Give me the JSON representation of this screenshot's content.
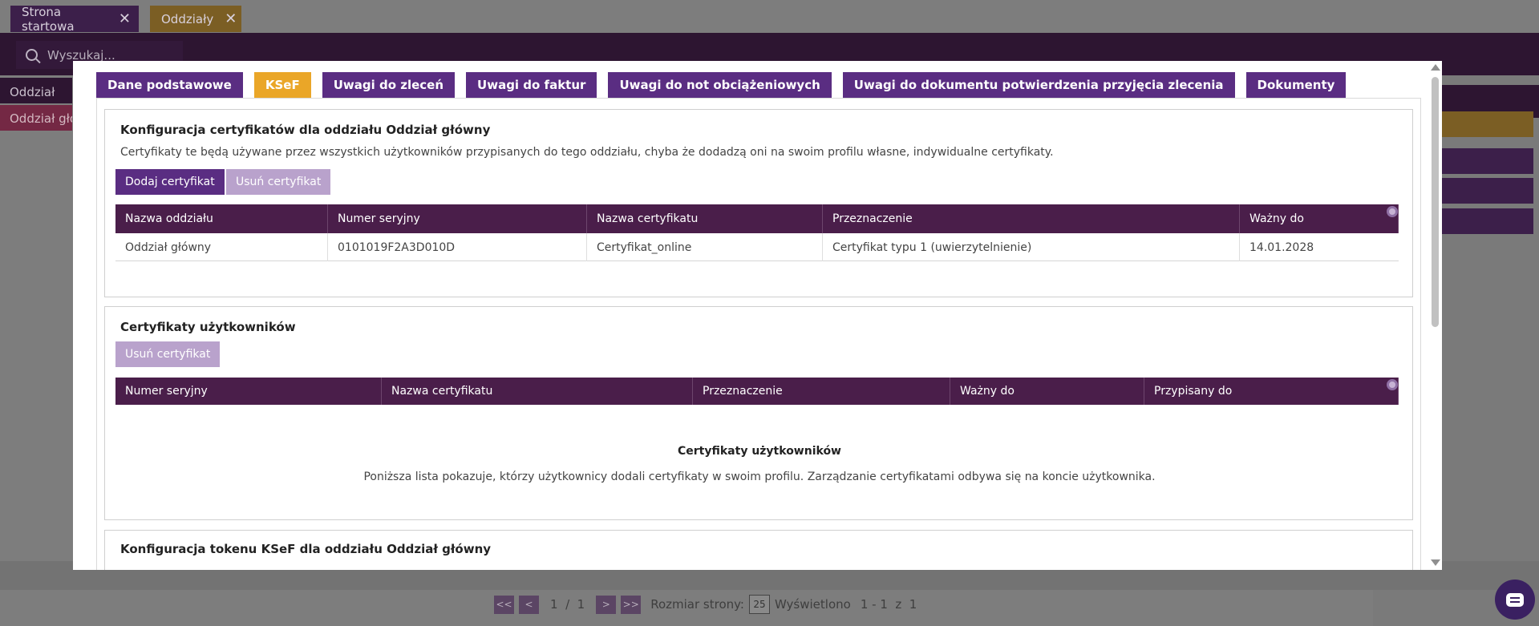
{
  "background": {
    "tabs": [
      {
        "label": "Strona startowa"
      },
      {
        "label": "Oddziały"
      }
    ],
    "search": {
      "placeholder": "Wyszukaj..."
    },
    "list": {
      "header": "Oddział",
      "selected": "Oddział główny"
    },
    "pager": {
      "first": "<<",
      "prev": "<",
      "page_info": "1  /  1",
      "next": ">",
      "last": ">>",
      "page_size_label": "Rozmiar strony:",
      "page_size": "25",
      "shown_label": "Wyświetlono",
      "shown_value": "1 - 1  z  1"
    }
  },
  "modal": {
    "tabs": [
      {
        "label": "Dane podstawowe",
        "active": false
      },
      {
        "label": "KSeF",
        "active": true
      },
      {
        "label": "Uwagi do zleceń",
        "active": false
      },
      {
        "label": "Uwagi do faktur",
        "active": false
      },
      {
        "label": "Uwagi do not obciążeniowych",
        "active": false
      },
      {
        "label": "Uwagi do dokumentu potwierdzenia przyjęcia zlecenia",
        "active": false
      },
      {
        "label": "Dokumenty",
        "active": false
      }
    ],
    "branch_certs": {
      "title": "Konfiguracja certyfikatów dla oddziału Oddział główny",
      "description": "Certyfikaty te będą używane przez wszystkich użytkowników przypisanych do tego oddziału, chyba że dodadzą oni na swoim profilu własne, indywidualne certyfikaty.",
      "add_button": "Dodaj certyfikat",
      "remove_button": "Usuń certyfikat",
      "columns": [
        "Nazwa oddziału",
        "Numer seryjny",
        "Nazwa certyfikatu",
        "Przeznaczenie",
        "Ważny do"
      ],
      "rows": [
        [
          "Oddział główny",
          "0101019F2A3D010D",
          "Certyfikat_online",
          "Certyfikat typu 1 (uwierzytelnienie)",
          "14.01.2028"
        ]
      ]
    },
    "user_certs": {
      "title": "Certyfikaty użytkowników",
      "remove_button": "Usuń certyfikat",
      "columns": [
        "Numer seryjny",
        "Nazwa certyfikatu",
        "Przeznaczenie",
        "Ważny do",
        "Przypisany do"
      ],
      "empty_title": "Certyfikaty użytkowników",
      "empty_description": "Poniższa lista pokazuje, którzy użytkownicy dodali certyfikaty w swoim profilu. Zarządzanie certyfikatami odbywa się na koncie użytkownika."
    },
    "token_config": {
      "title": "Konfiguracja tokenu KSeF dla oddziału Oddział główny"
    }
  },
  "colors": {
    "primary": "#5a2d82",
    "accent": "#eaa628",
    "grid_header": "#4a1e4a",
    "disabled": "#b9a2cc"
  },
  "icons": [
    "search-icon",
    "close-icon",
    "gear-icon",
    "chat-icon",
    "arrow-up-icon",
    "arrow-down-icon"
  ]
}
